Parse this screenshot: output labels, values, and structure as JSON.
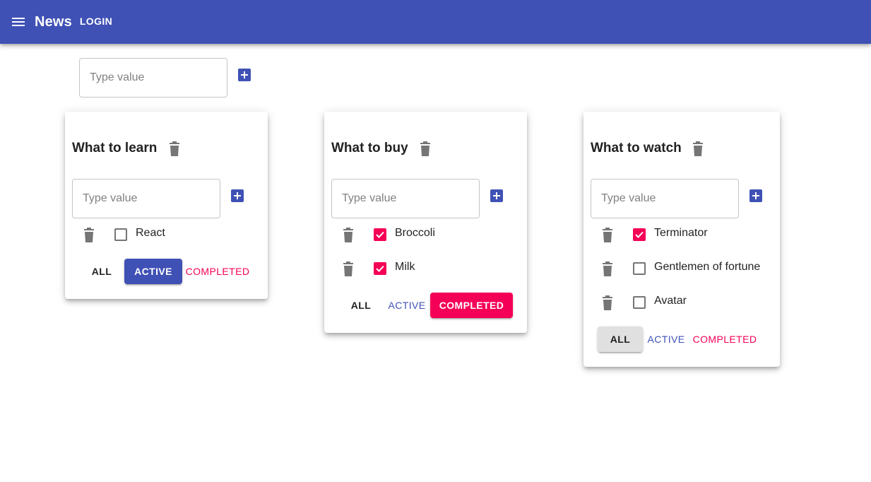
{
  "appbar": {
    "title": "News",
    "login_label": "LOGIN",
    "menu_icon": "menu-icon",
    "color": "#3f51b5"
  },
  "new_list": {
    "placeholder": "Type value",
    "add_icon": "add-box-icon"
  },
  "colors": {
    "primary": "#3f51b5",
    "secondary": "#f50057",
    "icon_grey": "#757575"
  },
  "todolists": [
    {
      "title": "What to learn",
      "input_placeholder": "Type value",
      "tasks": [
        {
          "title": "React",
          "done": false
        }
      ],
      "filters": {
        "all": "ALL",
        "active": "ACTIVE",
        "completed": "COMPLETED"
      },
      "selected_filter": "active"
    },
    {
      "title": "What to buy",
      "input_placeholder": "Type value",
      "tasks": [
        {
          "title": "Broccoli",
          "done": true
        },
        {
          "title": "Milk",
          "done": true
        }
      ],
      "filters": {
        "all": "ALL",
        "active": "ACTIVE",
        "completed": "COMPLETED"
      },
      "selected_filter": "completed"
    },
    {
      "title": "What to watch",
      "input_placeholder": "Type value",
      "tasks": [
        {
          "title": "Terminator",
          "done": true
        },
        {
          "title": "Gentlemen of fortune",
          "done": false
        },
        {
          "title": "Avatar",
          "done": false
        }
      ],
      "filters": {
        "all": "ALL",
        "active": "ACTIVE",
        "completed": "COMPLETED"
      },
      "selected_filter": "all"
    }
  ]
}
